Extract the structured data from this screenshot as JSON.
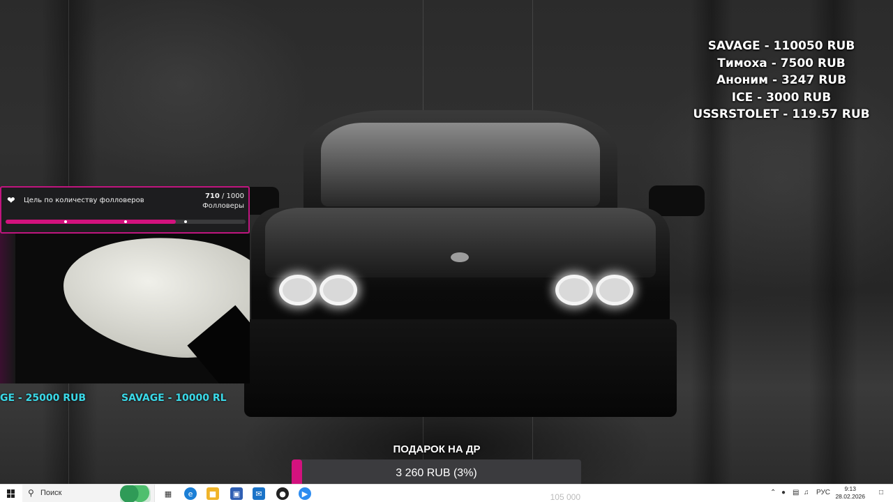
{
  "follower_goal": {
    "icon": "heart-icon",
    "title": "Цель по количеству фолловеров",
    "current": "710",
    "separator": " / ",
    "target": "1000",
    "unit": "Фолловеры",
    "progress_fraction": 0.71,
    "milestone_fractions": [
      0.25,
      0.5,
      0.75
    ],
    "accent": "#d3127e"
  },
  "donors": [
    "SAVAGE - 110050 RUB",
    "Тимоха - 7500 RUB",
    "Аноним - 3247 RUB",
    "ICE - 3000 RUB",
    "USSRSTOLET - 119.57 RUB"
  ],
  "ticker": {
    "items": [
      "GE - 25000 RUB",
      "SAVAGE - 10000 RL"
    ],
    "color": "#3ad9e8"
  },
  "birthday_goal": {
    "title": "ПОДАРОК НА ДР",
    "raised_label": "3 260 RUB (3%)",
    "target": "105 000",
    "progress_fraction": 0.03
  },
  "taskbar": {
    "search_placeholder": "Поиск",
    "language": "РУС",
    "time": "9:13",
    "date": "28.02.2026"
  }
}
